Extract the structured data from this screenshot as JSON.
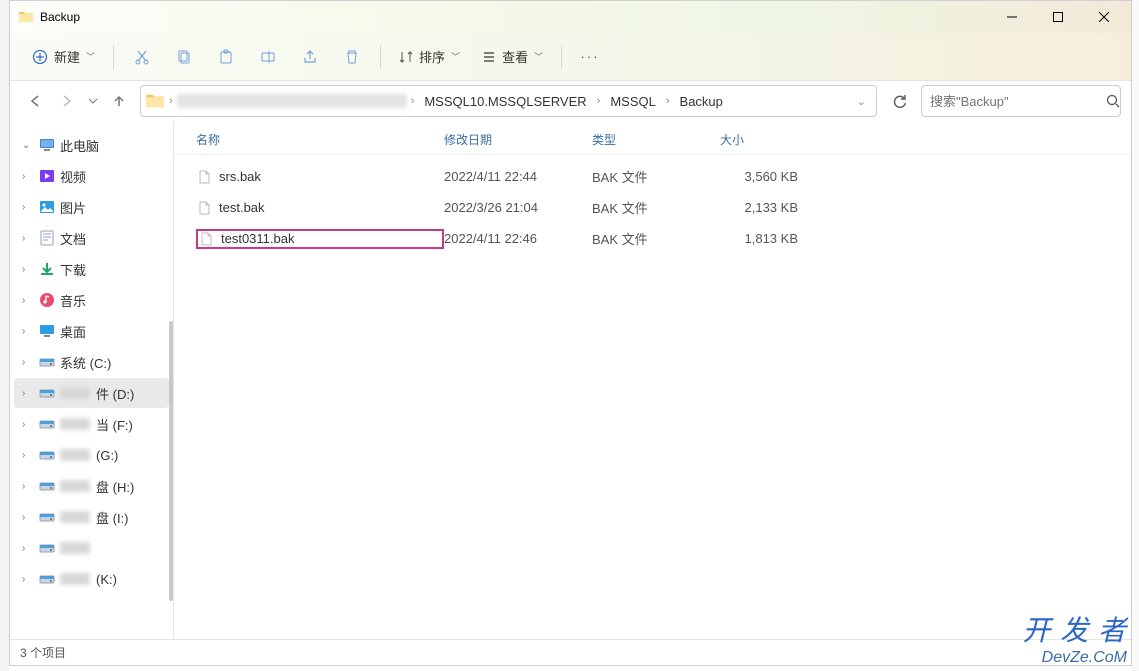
{
  "window": {
    "title": "Backup"
  },
  "toolbar": {
    "new_label": "新建",
    "sort_label": "排序",
    "view_label": "查看"
  },
  "breadcrumbs": [
    "MSSQL10.MSSQLSERVER",
    "MSSQL",
    "Backup"
  ],
  "search": {
    "placeholder": "搜索\"Backup\""
  },
  "sidebar": {
    "items": [
      {
        "label": "此电脑",
        "icon": "pc",
        "chv": "⌄"
      },
      {
        "label": "视频",
        "icon": "video",
        "chv": "›"
      },
      {
        "label": "图片",
        "icon": "pic",
        "chv": "›"
      },
      {
        "label": "文档",
        "icon": "doc",
        "chv": "›"
      },
      {
        "label": "下载",
        "icon": "dl",
        "chv": "›"
      },
      {
        "label": "音乐",
        "icon": "music",
        "chv": "›"
      },
      {
        "label": "桌面",
        "icon": "desk",
        "chv": "›"
      },
      {
        "label": "系统 (C:)",
        "icon": "drive",
        "chv": "›"
      },
      {
        "label": "件 (D:)",
        "icon": "drive",
        "chv": "›",
        "blurred": true,
        "selected": true
      },
      {
        "label": "当 (F:)",
        "icon": "drive",
        "chv": "›",
        "blurred": true
      },
      {
        "label": "  (G:)",
        "icon": "drive",
        "chv": "›",
        "blurred": true
      },
      {
        "label": "盘 (H:)",
        "icon": "drive",
        "chv": "›",
        "blurred": true
      },
      {
        "label": "盘 (I:)",
        "icon": "drive",
        "chv": "›",
        "blurred": true
      },
      {
        "label": "",
        "icon": "drive",
        "chv": "›",
        "blurred": true
      },
      {
        "label": " (K:)",
        "icon": "drive",
        "chv": "›",
        "blurred": true
      }
    ]
  },
  "columns": {
    "name": "名称",
    "modified": "修改日期",
    "type": "类型",
    "size": "大小"
  },
  "files": [
    {
      "name": "srs.bak",
      "modified": "2022/4/11 22:44",
      "type": "BAK 文件",
      "size": "3,560 KB",
      "highlight": false
    },
    {
      "name": "test.bak",
      "modified": "2022/3/26 21:04",
      "type": "BAK 文件",
      "size": "2,133 KB",
      "highlight": false
    },
    {
      "name": "test0311.bak",
      "modified": "2022/4/11 22:46",
      "type": "BAK 文件",
      "size": "1,813 KB",
      "highlight": true
    }
  ],
  "status": {
    "text": "3 个项目"
  },
  "watermark": {
    "line1": "开 发 者",
    "line2": "DevZe.CoM"
  }
}
